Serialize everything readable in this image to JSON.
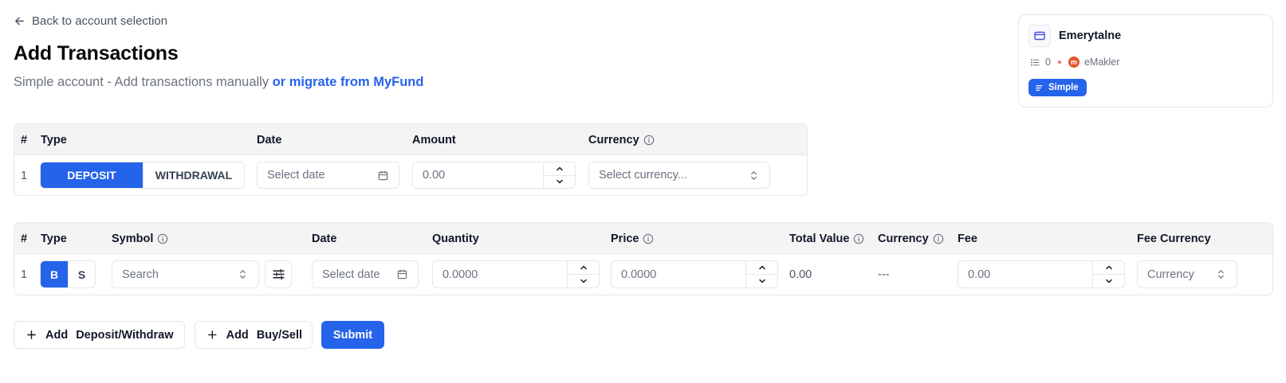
{
  "header": {
    "back_label": "Back to account selection",
    "title": "Add Transactions",
    "subtitle_plain": "Simple account - Add transactions manually ",
    "subtitle_link": "or migrate from MyFund"
  },
  "account": {
    "name": "Emerytalne",
    "transactions_count": "0",
    "broker_logo_letter": "m",
    "broker": "eMakler",
    "badge": "Simple"
  },
  "cash_table": {
    "headers": {
      "num": "#",
      "type": "Type",
      "date": "Date",
      "amount": "Amount",
      "currency": "Currency"
    },
    "rows": [
      {
        "num": "1",
        "type_options": [
          "DEPOSIT",
          "WITHDRAWAL"
        ],
        "selected_type": "DEPOSIT",
        "date_placeholder": "Select date",
        "amount": "0.00",
        "currency_placeholder": "Select currency..."
      }
    ]
  },
  "trade_table": {
    "headers": {
      "num": "#",
      "type": "Type",
      "symbol": "Symbol",
      "date": "Date",
      "quantity": "Quantity",
      "price": "Price",
      "total_value": "Total Value",
      "currency": "Currency",
      "fee": "Fee",
      "fee_currency": "Fee Currency"
    },
    "rows": [
      {
        "num": "1",
        "side_options": [
          "B",
          "S"
        ],
        "selected_side": "B",
        "symbol_placeholder": "Search",
        "date_placeholder": "Select date",
        "quantity": "0.0000",
        "price": "0.0000",
        "total_value": "0.00",
        "currency": "---",
        "fee": "0.00",
        "fee_currency_placeholder": "Currency"
      }
    ]
  },
  "actions": {
    "add_label": "Add",
    "deposit_withdraw_label": "Deposit/Withdraw",
    "buy_sell_label": "Buy/Sell",
    "submit_label": "Submit"
  },
  "colors": {
    "accent": "#2563eb",
    "header_bg": "#f4f4f5",
    "border": "#e5e7eb",
    "muted_text": "#6b7280"
  }
}
